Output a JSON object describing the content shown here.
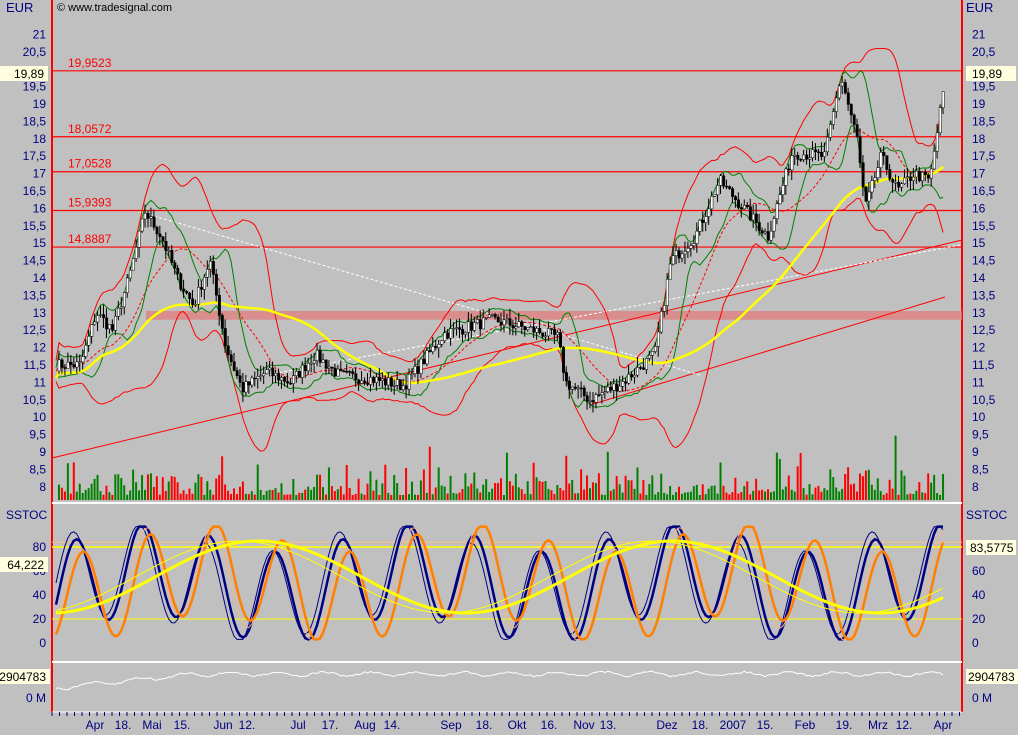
{
  "header": {
    "currency": "EUR",
    "copyright": "© www.tradesignal.com"
  },
  "colors": {
    "bg": "#c0c0c0",
    "axis": "#ff0000",
    "tick": "#000080",
    "up": "#008000",
    "down": "#ff0000",
    "sma": "#ffff00",
    "band": "#ff0000",
    "stoch1": "#000080",
    "stoch2": "#ff8000"
  },
  "chart_data": [
    {
      "type": "candlestick",
      "title": "Price",
      "ylabel": "EUR",
      "ylim": [
        8,
        21.5
      ],
      "yticks": [
        "21",
        "20,5",
        "20",
        "19,5",
        "19",
        "18,5",
        "18",
        "17,5",
        "17",
        "16,5",
        "16",
        "15,5",
        "15",
        "14,5",
        "14",
        "13,5",
        "13",
        "12,5",
        "12",
        "11,5",
        "11",
        "10,5",
        "10",
        "9,5",
        "9",
        "8,5",
        "8"
      ],
      "last_price": "19,89",
      "levels": [
        {
          "label": "19,9523",
          "value": 19.9523
        },
        {
          "label": "18,0572",
          "value": 18.0572
        },
        {
          "label": "17,0528",
          "value": 17.0528
        },
        {
          "label": "15,9393",
          "value": 15.9393
        },
        {
          "label": "14,8887",
          "value": 14.8887
        }
      ],
      "zone": [
        12.8,
        13.05
      ],
      "close_path": [
        [
          0,
          11.5
        ],
        [
          3,
          11.5
        ],
        [
          5,
          13
        ],
        [
          7,
          12.5
        ],
        [
          9,
          14
        ],
        [
          11,
          15.9
        ],
        [
          13,
          15.2
        ],
        [
          15,
          14
        ],
        [
          17,
          13.2
        ],
        [
          19,
          14.5
        ],
        [
          21,
          12
        ],
        [
          23,
          10.8
        ],
        [
          26,
          11.3
        ],
        [
          29,
          11
        ],
        [
          32,
          11.8
        ],
        [
          35,
          11.2
        ],
        [
          39,
          11.1
        ],
        [
          43,
          10.9
        ],
        [
          45,
          11.5
        ],
        [
          48,
          12.4
        ],
        [
          54,
          12.8
        ],
        [
          59,
          12.5
        ],
        [
          62,
          12.3
        ],
        [
          63,
          11
        ],
        [
          66,
          10.5
        ],
        [
          70,
          11
        ],
        [
          74,
          11.8
        ],
        [
          76,
          14.5
        ],
        [
          79,
          15.2
        ],
        [
          82,
          16.8
        ],
        [
          85,
          16
        ],
        [
          88,
          15.2
        ],
        [
          91,
          17.6
        ],
        [
          95,
          17.5
        ],
        [
          97,
          19.8
        ],
        [
          99,
          18
        ],
        [
          100,
          16
        ],
        [
          102,
          17.5
        ],
        [
          104,
          16.5
        ],
        [
          106,
          17
        ],
        [
          108,
          16.8
        ],
        [
          110,
          19.9
        ]
      ]
    },
    {
      "type": "line",
      "title": "SSTOC",
      "ylim": [
        -25,
        100
      ],
      "yticks": [
        "80",
        "60",
        "40",
        "20",
        "0"
      ],
      "current": "64,222",
      "last": "83,5775",
      "bands": [
        20,
        80
      ]
    },
    {
      "type": "line",
      "title": "Volume cumulative",
      "current": "2904783",
      "yticks": [
        "0 M"
      ]
    }
  ],
  "xaxis": [
    "Apr",
    "18.",
    "Mai",
    "15.",
    "Jun",
    "12.",
    "Jul",
    "17.",
    "Aug",
    "14.",
    "Sep",
    "18.",
    "Okt",
    "16.",
    "Nov",
    "13.",
    "Dez",
    "18.",
    "2007",
    "15.",
    "Feb",
    "19.",
    "Mrz",
    "12.",
    "Apr"
  ]
}
